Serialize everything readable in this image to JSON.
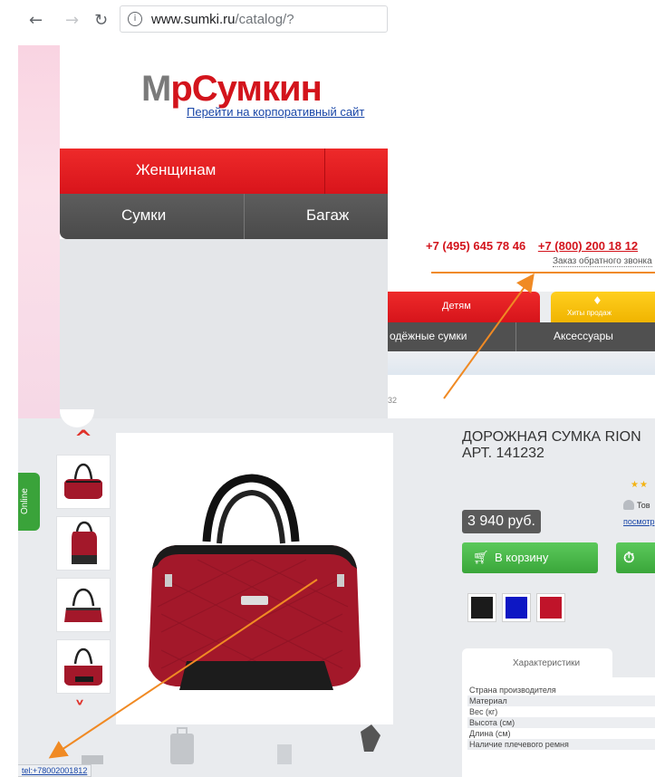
{
  "browser": {
    "url_host": "www.sumki.ru",
    "url_path": "/catalog/?"
  },
  "site": {
    "logo_prefix": "М",
    "logo_dot": "р",
    "logo_main": "Сумкин",
    "corp_link": "Перейти на корпоративный сайт",
    "menu_main": [
      "Женщинам"
    ],
    "menu_sub": [
      "Сумки",
      "Багаж"
    ]
  },
  "header_right": {
    "phone_1": "+7 (495) 645 78 46",
    "phone_2": "+7 (800) 200 18 12",
    "callback": "Заказ обратного звонка",
    "tab_kids": "Детям",
    "tab_hits": "Хиты продаж",
    "sub_items": [
      "одёжные сумки",
      "Аксессуары"
    ],
    "article_fragment": "32"
  },
  "product": {
    "title": "ДОРОЖНАЯ СУМКА RION АРТ. 141232",
    "price": "3 940 руб.",
    "cart_button": "В корзину",
    "favorite_fragment": "Тов",
    "watch_fragment": "посмотр",
    "rating_stars": 2,
    "swatch_colors": [
      "#1b1b1b",
      "#0d17c4",
      "#c0142a"
    ],
    "tab_label": "Характеристики",
    "spec_rows": [
      "Страна производителя",
      "Материал",
      "Вес (кг)",
      "Высота (см)",
      "Длина (см)",
      "Наличие плечевого ремня"
    ]
  },
  "sidebar": {
    "online_label": "Online"
  },
  "status_bar": {
    "link": "tel:+78002001812"
  },
  "colors": {
    "brand_red": "#d3141c",
    "dark_menu": "#505050",
    "green_button": "#3aa63a",
    "hits_yellow": "#f0b400",
    "annotation_orange": "#f08a24"
  }
}
